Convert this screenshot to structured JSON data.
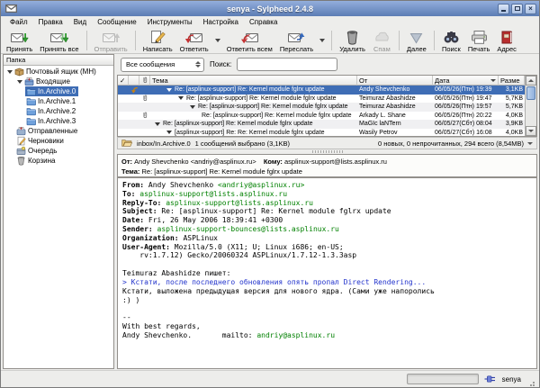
{
  "window": {
    "title": "senya - Sylpheed 2.4.8"
  },
  "menu": {
    "items": [
      "Файл",
      "Правка",
      "Вид",
      "Сообщение",
      "Инструменты",
      "Настройка",
      "Справка"
    ],
    "ids": [
      "file",
      "edit",
      "view",
      "message",
      "tools",
      "configuration",
      "help"
    ]
  },
  "toolbar": {
    "buttons": [
      {
        "label": "Принять",
        "icon": "receive-icon"
      },
      {
        "label": "Принять все",
        "icon": "receive-all-icon"
      },
      {
        "type": "sep"
      },
      {
        "label": "Отправить",
        "icon": "send-icon",
        "disabled": true
      },
      {
        "type": "sep"
      },
      {
        "label": "Написать",
        "icon": "compose-icon"
      },
      {
        "label": "Ответить",
        "icon": "reply-icon",
        "dropdown": true
      },
      {
        "label": "Ответить всем",
        "icon": "reply-all-icon"
      },
      {
        "label": "Переслать",
        "icon": "forward-icon",
        "dropdown": true
      },
      {
        "type": "sep"
      },
      {
        "label": "Удалить",
        "icon": "delete-icon"
      },
      {
        "label": "Спам",
        "icon": "junk-icon",
        "disabled": true
      },
      {
        "type": "sep"
      },
      {
        "label": "Далее",
        "icon": "next-icon"
      },
      {
        "type": "sep"
      },
      {
        "label": "Поиск",
        "icon": "search-icon"
      },
      {
        "label": "Печать",
        "icon": "print-icon"
      },
      {
        "label": "Адрес",
        "icon": "address-icon"
      }
    ]
  },
  "folder_pane": {
    "header": "Папка",
    "items": [
      {
        "id": "mailbox-root",
        "label": "Почтовый ящик (MH)",
        "icon": "mailbox-icon",
        "depth": 0,
        "expanded": true
      },
      {
        "id": "inbox",
        "label": "Входящие",
        "icon": "inbox-icon",
        "depth": 1,
        "expanded": true
      },
      {
        "id": "in-archive-0",
        "label": "In.Archive.0",
        "icon": "folder-icon",
        "depth": 2,
        "selected": true
      },
      {
        "id": "in-archive-1",
        "label": "In.Archive.1",
        "icon": "folder-icon",
        "depth": 2
      },
      {
        "id": "in-archive-2",
        "label": "In.Archive.2",
        "icon": "folder-icon",
        "depth": 2
      },
      {
        "id": "in-archive-3",
        "label": "In.Archive.3",
        "icon": "folder-icon",
        "depth": 2
      },
      {
        "id": "sent",
        "label": "Отправленные",
        "icon": "sent-icon",
        "depth": 1
      },
      {
        "id": "drafts",
        "label": "Черновики",
        "icon": "draft-icon",
        "depth": 1
      },
      {
        "id": "queue",
        "label": "Очередь",
        "icon": "queue-icon",
        "depth": 1
      },
      {
        "id": "trash",
        "label": "Корзина",
        "icon": "trash-icon",
        "depth": 1
      }
    ]
  },
  "filter_bar": {
    "filter_value": "Все сообщения",
    "search_label": "Поиск:",
    "search_value": ""
  },
  "message_list": {
    "columns": [
      {
        "key": "mark",
        "label": "✓",
        "width": 12
      },
      {
        "key": "status",
        "icon": "envelope-icon",
        "width": 12
      },
      {
        "key": "attach",
        "icon": "paperclip-icon",
        "width": 12
      },
      {
        "key": "subject",
        "label": "Тема"
      },
      {
        "key": "from",
        "label": "От",
        "width": 84
      },
      {
        "key": "date",
        "label": "Дата",
        "width": 73,
        "sort": "desc"
      },
      {
        "key": "size",
        "label": "Разме",
        "width": 29
      }
    ],
    "rows": [
      {
        "status_icon": "reply-arrow-icon",
        "expander": true,
        "level": 1,
        "selected": true,
        "subject": "Re: [asplinux-support] Re: Kernel module fglrx update",
        "from": "Andy Shevchenko",
        "date": "06/05/26(Птн) 19:39",
        "size": "3,1KB"
      },
      {
        "attach": true,
        "expander": true,
        "level": 2,
        "subject": "Re: [asplinux-support] Re: Kernel module fglrx update",
        "from": "Teimuraz Abashidze",
        "date": "06/05/26(Птн) 19:47",
        "size": "5,7KB"
      },
      {
        "expander": true,
        "level": 3,
        "subject": "Re: [asplinux-support] Re: Kernel module fglrx update",
        "from": "Teimuraz Abashidze",
        "date": "06/05/26(Птн) 19:57",
        "size": "5,7KB"
      },
      {
        "attach": true,
        "expander": false,
        "level": 4,
        "subject": "Re: [asplinux-support] Re: Kernel module fglrx update",
        "from": "Arkady L. Shane",
        "date": "06/05/26(Птн) 20:22",
        "size": "4,0KB"
      },
      {
        "expander": true,
        "level": 0,
        "subject": "Re: [asplinux-support] Re: Kernel module fglrx update",
        "from": "MaGIc laNTern",
        "date": "06/05/27(Сбт) 08:04",
        "size": "3,9KB"
      },
      {
        "expander": true,
        "level": 1,
        "subject": "[asplinux-support] Re: Re: Kernel module fglrx update",
        "from": "Wasily Petrov",
        "date": "06/05/27(Сбт) 16:08",
        "size": "4,0KB"
      }
    ]
  },
  "list_status": {
    "folder": "inbox/In.Archive.0",
    "selection": "1 сообщений выбрано (3,1KB)",
    "counts": "0 новых, 0 непрочитанных, 294 всего (8,54MB)"
  },
  "summary": {
    "from_label": "От:",
    "from_value": "Andy Shevchenko <andriy@asplinux.ru>",
    "to_label": "Кому:",
    "to_value": "asplinux-support@lists.asplinux.ru",
    "subject_label": "Тема:",
    "subject_value": "Re: [asplinux-support] Re: Kernel module fglrx update"
  },
  "message": {
    "headers": [
      {
        "label": "From:",
        "value": "Andy Shevchenko ",
        "link": "<andriy@asplinux.ru>"
      },
      {
        "label": "To:",
        "link": "asplinux-support@lists.asplinux.ru"
      },
      {
        "label": "Reply-To:",
        "link": "asplinux-support@lists.asplinux.ru"
      },
      {
        "label": "Subject:",
        "value": "Re: [asplinux-support] Re: Kernel module fglrx update"
      },
      {
        "label": "Date:",
        "value": "Fri, 26 May 2006 18:39:41 +0300"
      },
      {
        "label": "Sender:",
        "link": "asplinux-support-bounces@lists.asplinux.ru"
      },
      {
        "label": "Organization:",
        "value": "ASPLinux"
      },
      {
        "label": "User-Agent:",
        "value": "Mozilla/5.0 (X11; U; Linux i686; en-US;"
      },
      {
        "label": "",
        "value": "    rv:1.7.12) Gecko/20060324 ASPLinux/1.7.12-1.3.3asp"
      }
    ],
    "body": [
      {
        "text": "Teimuraz Abashidze пишет:"
      },
      {
        "text": "> Кстати, после последнего обновления опять пропал Direct Rendering...",
        "quote": true
      },
      {
        "text": "Кстати, выложена предыдущая версия для нового ядра. (Сами уже напоролись"
      },
      {
        "text": ":) )"
      },
      {
        "text": ""
      },
      {
        "text": "--"
      },
      {
        "text": "With best regards,"
      },
      {
        "text": "Andy Shevchenko.       mailto: ",
        "link": "andriy@asplinux.ru"
      }
    ]
  },
  "status_bar": {
    "account": "senya"
  },
  "colors": {
    "selection": "#3E6DB5",
    "link_green": "#008000",
    "quote_blue": "#2233CC",
    "titlebar_top": "#93AEDC",
    "titlebar_bottom": "#5C7DB4"
  }
}
